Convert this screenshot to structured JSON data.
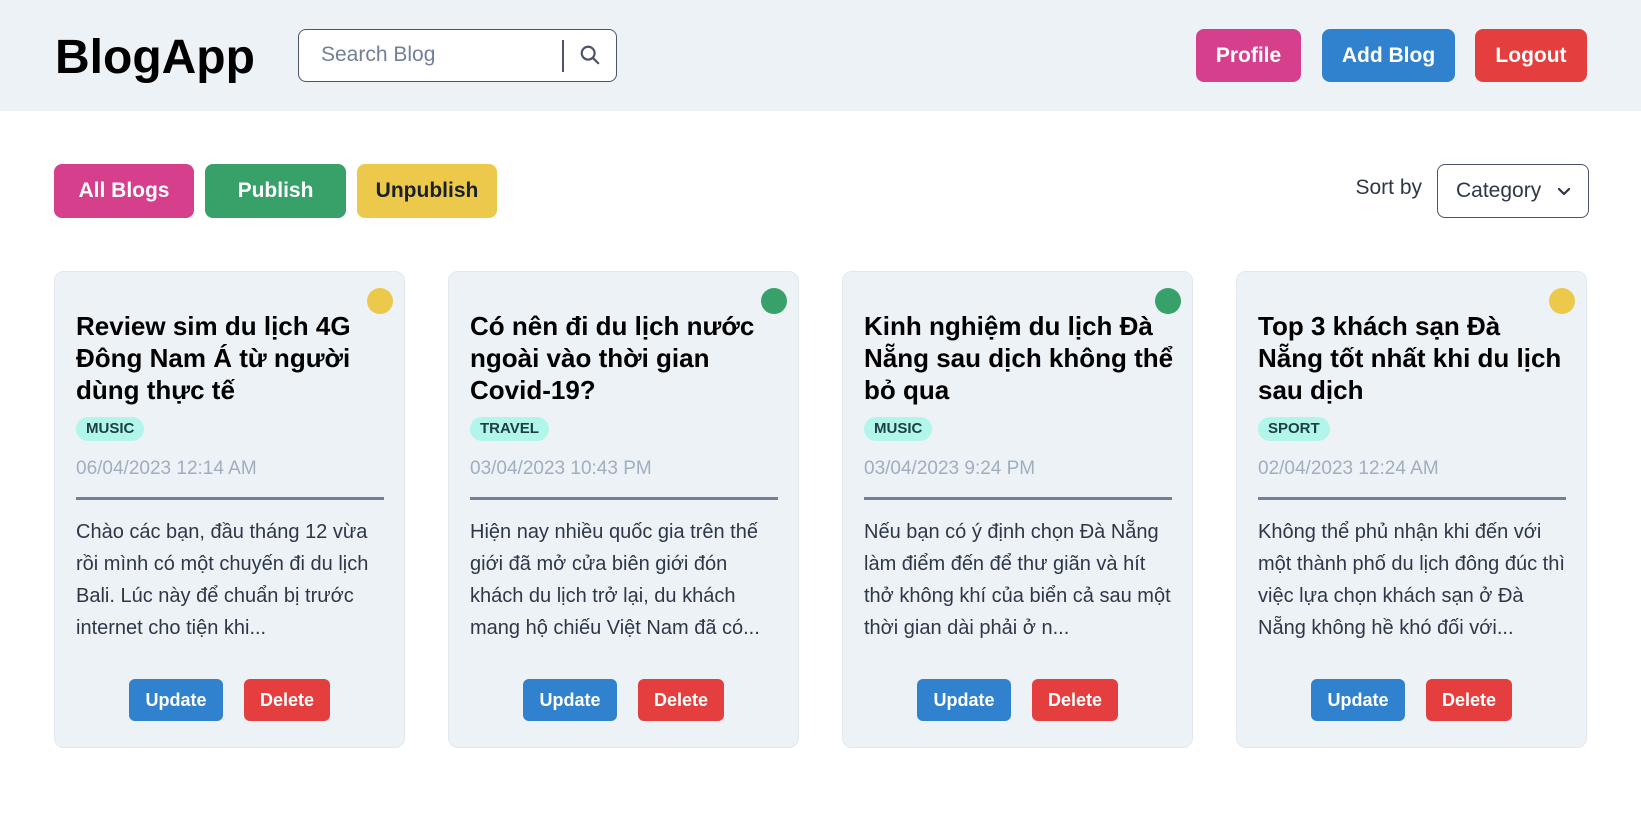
{
  "header": {
    "brand": "BlogApp",
    "search_placeholder": "Search Blog",
    "buttons": {
      "profile": "Profile",
      "add_blog": "Add Blog",
      "logout": "Logout"
    }
  },
  "filters": {
    "all": "All Blogs",
    "publish": "Publish",
    "unpublish": "Unpublish"
  },
  "sort": {
    "label": "Sort by",
    "selected": "Category"
  },
  "colors": {
    "published": "#38a169",
    "unpublished": "#ecc94b"
  },
  "cards": [
    {
      "status": "unpublished",
      "title": "Review sim du lịch 4G Đông Nam Á từ người dùng thực tế",
      "category": "MUSIC",
      "date": "06/04/2023 12:14 AM",
      "excerpt": "Chào các bạn, đầu tháng 12 vừa rồi mình có một chuyến đi du lịch Bali. Lúc này để chuẩn bị trước internet cho tiện khi...",
      "update_label": "Update",
      "delete_label": "Delete"
    },
    {
      "status": "published",
      "title": "Có nên đi du lịch nước ngoài vào thời gian Covid-19?",
      "category": "TRAVEL",
      "date": "03/04/2023 10:43 PM",
      "excerpt": "Hiện nay nhiều quốc gia trên thế giới đã mở cửa biên giới đón khách du lịch trở lại, du khách mang hộ chiếu Việt Nam đã có...",
      "update_label": "Update",
      "delete_label": "Delete"
    },
    {
      "status": "published",
      "title": "Kinh nghiệm du lịch Đà Nẵng sau dịch không thể bỏ qua",
      "category": "MUSIC",
      "date": "03/04/2023 9:24 PM",
      "excerpt": "Nếu bạn có ý định chọn Đà Nẵng làm điểm đến để thư giãn và hít thở không khí của biển cả sau một thời gian dài phải ở n...",
      "update_label": "Update",
      "delete_label": "Delete"
    },
    {
      "status": "unpublished",
      "title": "Top 3 khách sạn Đà Nẵng tốt nhất khi du lịch sau dịch",
      "category": "SPORT",
      "date": "02/04/2023 12:24 AM",
      "excerpt": "Không thể phủ nhận khi đến với một thành phố du lịch đông đúc thì việc lựa chọn khách sạn ở Đà Nẵng không hề khó đối với...",
      "update_label": "Update",
      "delete_label": "Delete"
    }
  ]
}
